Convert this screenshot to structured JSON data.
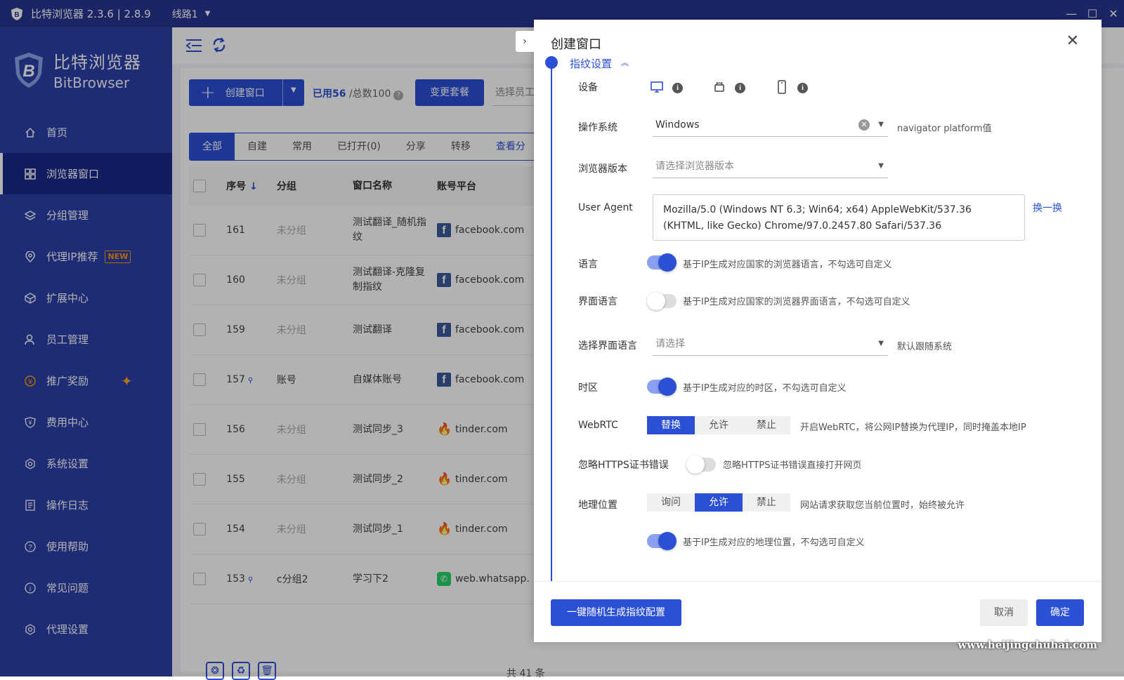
{
  "titlebar": {
    "title": "比特浏览器 2.3.6 | 2.8.9",
    "line": "线路1"
  },
  "sidebar": {
    "brand_cn": "比特浏览器",
    "brand_en": "BitBrowser",
    "items": [
      {
        "label": "首页",
        "icon": "home-icon"
      },
      {
        "label": "浏览器窗口",
        "icon": "grid-icon"
      },
      {
        "label": "分组管理",
        "icon": "layers-icon"
      },
      {
        "label": "代理IP推荐",
        "icon": "location-icon",
        "badge": "NEW"
      },
      {
        "label": "扩展中心",
        "icon": "cube-icon"
      },
      {
        "label": "员工管理",
        "icon": "user-icon"
      },
      {
        "label": "推广奖励",
        "icon": "coin-icon"
      },
      {
        "label": "费用中心",
        "icon": "yen-shield-icon"
      },
      {
        "label": "系统设置",
        "icon": "settings-icon"
      },
      {
        "label": "操作日志",
        "icon": "log-icon"
      },
      {
        "label": "使用帮助",
        "icon": "help-icon"
      },
      {
        "label": "常见问题",
        "icon": "info-icon"
      },
      {
        "label": "代理设置",
        "icon": "proxy-settings-icon"
      }
    ]
  },
  "toolbar": {
    "create_label": "创建窗口",
    "used": "已用56",
    "total": "/总数100",
    "change_plan": "变更套餐",
    "select_employee": "选择员工"
  },
  "tabs": [
    "全部",
    "自建",
    "常用",
    "已打开(0)",
    "分享",
    "转移",
    "查看分"
  ],
  "table": {
    "headers": {
      "no": "序号",
      "group": "分组",
      "name": "窗口名称",
      "platform": "账号平台"
    },
    "rows": [
      {
        "no": "161",
        "group": "未分组",
        "name": "测试翻译_随机指纹",
        "platform": "facebook.com"
      },
      {
        "no": "160",
        "group": "未分组",
        "name": "测试翻译-克隆复制指纹",
        "platform": "facebook.com"
      },
      {
        "no": "159",
        "group": "未分组",
        "name": "测试翻译",
        "platform": "facebook.com"
      },
      {
        "no": "157",
        "group": "账号",
        "name": "自媒体账号",
        "platform": "facebook.com"
      },
      {
        "no": "156",
        "group": "未分组",
        "name": "测试同步_3",
        "platform": "tinder.com"
      },
      {
        "no": "155",
        "group": "未分组",
        "name": "测试同步_2",
        "platform": "tinder.com"
      },
      {
        "no": "154",
        "group": "未分组",
        "name": "测试同步_1",
        "platform": "tinder.com"
      },
      {
        "no": "153",
        "group": "c分组2",
        "name": "学习下2",
        "platform": "web.whatsapp."
      }
    ],
    "total_text": "共 41 条"
  },
  "drawer": {
    "title": "创建窗口",
    "section": "指纹设置",
    "device_label": "设备",
    "os_label": "操作系统",
    "os_value": "Windows",
    "os_hint": "navigator platform值",
    "browser_version_label": "浏览器版本",
    "browser_version_placeholder": "请选择浏览器版本",
    "ua_label": "User Agent",
    "ua_value": "Mozilla/5.0 (Windows NT 6.3; Win64; x64) AppleWebKit/537.36 (KHTML, like Gecko) Chrome/97.0.2457.80 Safari/537.36",
    "ua_swap": "换一换",
    "language_label": "语言",
    "language_hint": "基于IP生成对应国家的浏览器语言，不勾选可自定义",
    "language_on": true,
    "ui_language_label": "界面语言",
    "ui_language_hint": "基于IP生成对应国家的浏览器界面语言，不勾选可自定义",
    "ui_language_on": false,
    "select_ui_language_label": "选择界面语言",
    "select_ui_language_placeholder": "请选择",
    "select_ui_language_hint": "默认跟随系统",
    "timezone_label": "时区",
    "timezone_hint": "基于IP生成对应的时区，不勾选可自定义",
    "timezone_on": true,
    "webrtc_label": "WebRTC",
    "webrtc_options": [
      "替换",
      "允许",
      "禁止"
    ],
    "webrtc_selected": "替换",
    "webrtc_hint": "开启WebRTC，将公网IP替换为代理IP，同时掩盖本地IP",
    "https_label": "忽略HTTPS证书错误",
    "https_hint": "忽略HTTPS证书错误直接打开网页",
    "https_on": false,
    "geo_label": "地理位置",
    "geo_options": [
      "询问",
      "允许",
      "禁止"
    ],
    "geo_selected": "允许",
    "geo_hint": "网站请求获取您当前位置时，始终被允许",
    "geo_ip_hint": "基于IP生成对应的地理位置，不勾选可自定义",
    "geo_ip_on": true,
    "random_button": "一键随机生成指纹配置",
    "cancel_button": "取消",
    "ok_button": "确定"
  },
  "watermark": "www.heijingchuhai.com",
  "colors": {
    "primary": "#2b50d6",
    "sidebar": "#2b40a8",
    "titlebar": "#283593",
    "badge": "#ff9800"
  }
}
